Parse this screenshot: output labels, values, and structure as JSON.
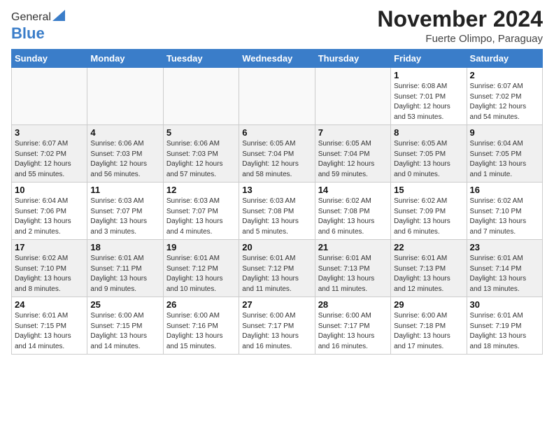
{
  "header": {
    "logo_general": "General",
    "logo_blue": "Blue",
    "title": "November 2024",
    "subtitle": "Fuerte Olimpo, Paraguay"
  },
  "weekdays": [
    "Sunday",
    "Monday",
    "Tuesday",
    "Wednesday",
    "Thursday",
    "Friday",
    "Saturday"
  ],
  "weeks": [
    [
      {
        "day": "",
        "info": ""
      },
      {
        "day": "",
        "info": ""
      },
      {
        "day": "",
        "info": ""
      },
      {
        "day": "",
        "info": ""
      },
      {
        "day": "",
        "info": ""
      },
      {
        "day": "1",
        "info": "Sunrise: 6:08 AM\nSunset: 7:01 PM\nDaylight: 12 hours\nand 53 minutes."
      },
      {
        "day": "2",
        "info": "Sunrise: 6:07 AM\nSunset: 7:02 PM\nDaylight: 12 hours\nand 54 minutes."
      }
    ],
    [
      {
        "day": "3",
        "info": "Sunrise: 6:07 AM\nSunset: 7:02 PM\nDaylight: 12 hours\nand 55 minutes."
      },
      {
        "day": "4",
        "info": "Sunrise: 6:06 AM\nSunset: 7:03 PM\nDaylight: 12 hours\nand 56 minutes."
      },
      {
        "day": "5",
        "info": "Sunrise: 6:06 AM\nSunset: 7:03 PM\nDaylight: 12 hours\nand 57 minutes."
      },
      {
        "day": "6",
        "info": "Sunrise: 6:05 AM\nSunset: 7:04 PM\nDaylight: 12 hours\nand 58 minutes."
      },
      {
        "day": "7",
        "info": "Sunrise: 6:05 AM\nSunset: 7:04 PM\nDaylight: 12 hours\nand 59 minutes."
      },
      {
        "day": "8",
        "info": "Sunrise: 6:05 AM\nSunset: 7:05 PM\nDaylight: 13 hours\nand 0 minutes."
      },
      {
        "day": "9",
        "info": "Sunrise: 6:04 AM\nSunset: 7:05 PM\nDaylight: 13 hours\nand 1 minute."
      }
    ],
    [
      {
        "day": "10",
        "info": "Sunrise: 6:04 AM\nSunset: 7:06 PM\nDaylight: 13 hours\nand 2 minutes."
      },
      {
        "day": "11",
        "info": "Sunrise: 6:03 AM\nSunset: 7:07 PM\nDaylight: 13 hours\nand 3 minutes."
      },
      {
        "day": "12",
        "info": "Sunrise: 6:03 AM\nSunset: 7:07 PM\nDaylight: 13 hours\nand 4 minutes."
      },
      {
        "day": "13",
        "info": "Sunrise: 6:03 AM\nSunset: 7:08 PM\nDaylight: 13 hours\nand 5 minutes."
      },
      {
        "day": "14",
        "info": "Sunrise: 6:02 AM\nSunset: 7:08 PM\nDaylight: 13 hours\nand 6 minutes."
      },
      {
        "day": "15",
        "info": "Sunrise: 6:02 AM\nSunset: 7:09 PM\nDaylight: 13 hours\nand 6 minutes."
      },
      {
        "day": "16",
        "info": "Sunrise: 6:02 AM\nSunset: 7:10 PM\nDaylight: 13 hours\nand 7 minutes."
      }
    ],
    [
      {
        "day": "17",
        "info": "Sunrise: 6:02 AM\nSunset: 7:10 PM\nDaylight: 13 hours\nand 8 minutes."
      },
      {
        "day": "18",
        "info": "Sunrise: 6:01 AM\nSunset: 7:11 PM\nDaylight: 13 hours\nand 9 minutes."
      },
      {
        "day": "19",
        "info": "Sunrise: 6:01 AM\nSunset: 7:12 PM\nDaylight: 13 hours\nand 10 minutes."
      },
      {
        "day": "20",
        "info": "Sunrise: 6:01 AM\nSunset: 7:12 PM\nDaylight: 13 hours\nand 11 minutes."
      },
      {
        "day": "21",
        "info": "Sunrise: 6:01 AM\nSunset: 7:13 PM\nDaylight: 13 hours\nand 11 minutes."
      },
      {
        "day": "22",
        "info": "Sunrise: 6:01 AM\nSunset: 7:13 PM\nDaylight: 13 hours\nand 12 minutes."
      },
      {
        "day": "23",
        "info": "Sunrise: 6:01 AM\nSunset: 7:14 PM\nDaylight: 13 hours\nand 13 minutes."
      }
    ],
    [
      {
        "day": "24",
        "info": "Sunrise: 6:01 AM\nSunset: 7:15 PM\nDaylight: 13 hours\nand 14 minutes."
      },
      {
        "day": "25",
        "info": "Sunrise: 6:00 AM\nSunset: 7:15 PM\nDaylight: 13 hours\nand 14 minutes."
      },
      {
        "day": "26",
        "info": "Sunrise: 6:00 AM\nSunset: 7:16 PM\nDaylight: 13 hours\nand 15 minutes."
      },
      {
        "day": "27",
        "info": "Sunrise: 6:00 AM\nSunset: 7:17 PM\nDaylight: 13 hours\nand 16 minutes."
      },
      {
        "day": "28",
        "info": "Sunrise: 6:00 AM\nSunset: 7:17 PM\nDaylight: 13 hours\nand 16 minutes."
      },
      {
        "day": "29",
        "info": "Sunrise: 6:00 AM\nSunset: 7:18 PM\nDaylight: 13 hours\nand 17 minutes."
      },
      {
        "day": "30",
        "info": "Sunrise: 6:01 AM\nSunset: 7:19 PM\nDaylight: 13 hours\nand 18 minutes."
      }
    ]
  ]
}
